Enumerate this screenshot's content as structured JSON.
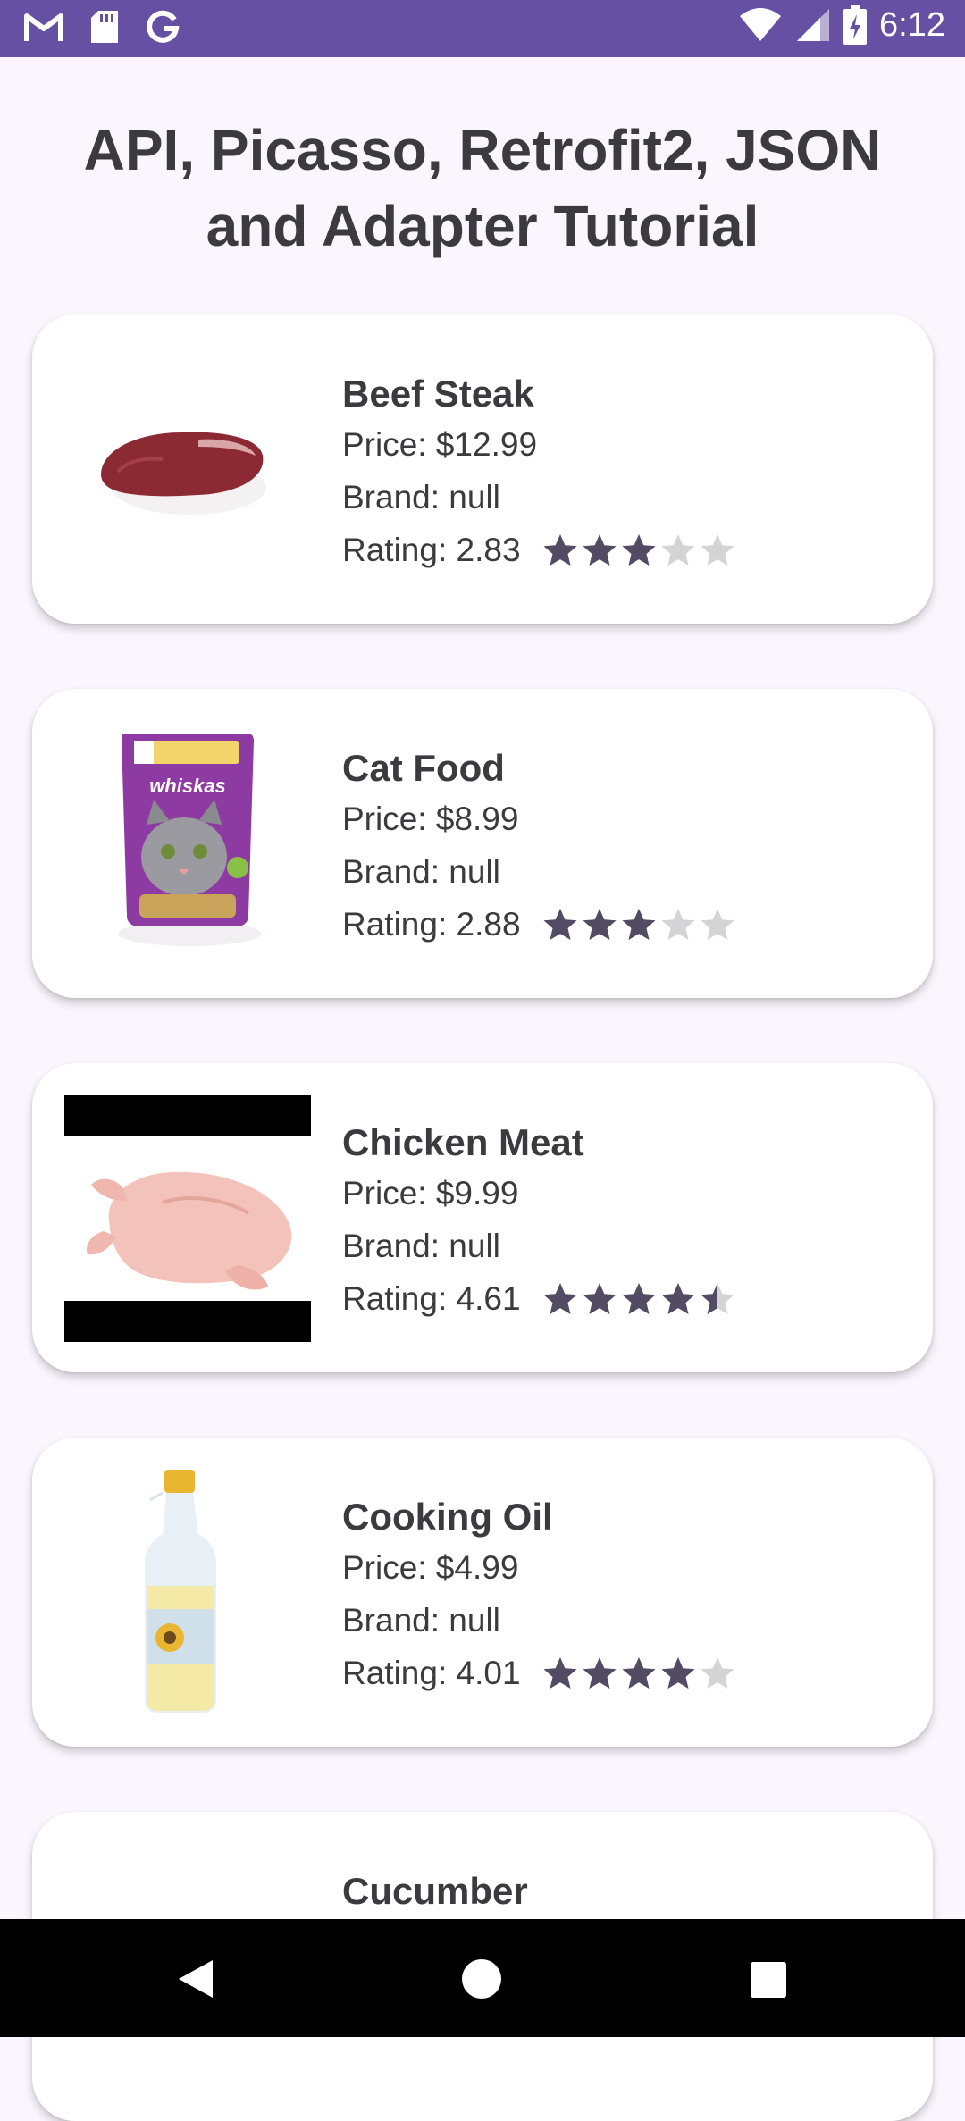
{
  "status_bar": {
    "time": "6:12",
    "left_icons": [
      "gmail-icon",
      "sd-card-icon",
      "google-icon"
    ],
    "right_icons": [
      "wifi-icon",
      "signal-icon",
      "battery-charging-icon"
    ],
    "color": "#6650a4"
  },
  "title": "API, Picasso, Retrofit2, JSON and Adapter Tutorial",
  "products": [
    {
      "name": "Beef Steak",
      "price": "Price: $12.99",
      "brand": "Brand: null",
      "rating_label": "Rating: 2.83",
      "rating": 2.83,
      "image": "beef-steak"
    },
    {
      "name": "Cat Food",
      "price": "Price: $8.99",
      "brand": "Brand: null",
      "rating_label": "Rating: 2.88",
      "rating": 2.88,
      "image": "cat-food"
    },
    {
      "name": "Chicken Meat",
      "price": "Price: $9.99",
      "brand": "Brand: null",
      "rating_label": "Rating: 4.61",
      "rating": 4.61,
      "image": "chicken-meat"
    },
    {
      "name": "Cooking Oil",
      "price": "Price: $4.99",
      "brand": "Brand: null",
      "rating_label": "Rating: 4.01",
      "rating": 4.01,
      "image": "cooking-oil"
    },
    {
      "name": "Cucumber",
      "image": "cucumber"
    }
  ],
  "nav_bar": {
    "buttons": [
      "back-icon",
      "home-icon",
      "recents-icon"
    ]
  },
  "colors": {
    "star_filled": "#524b63",
    "star_empty": "#d4d4d6",
    "text": "#3b3b3f",
    "background": "#fbf5fd"
  }
}
